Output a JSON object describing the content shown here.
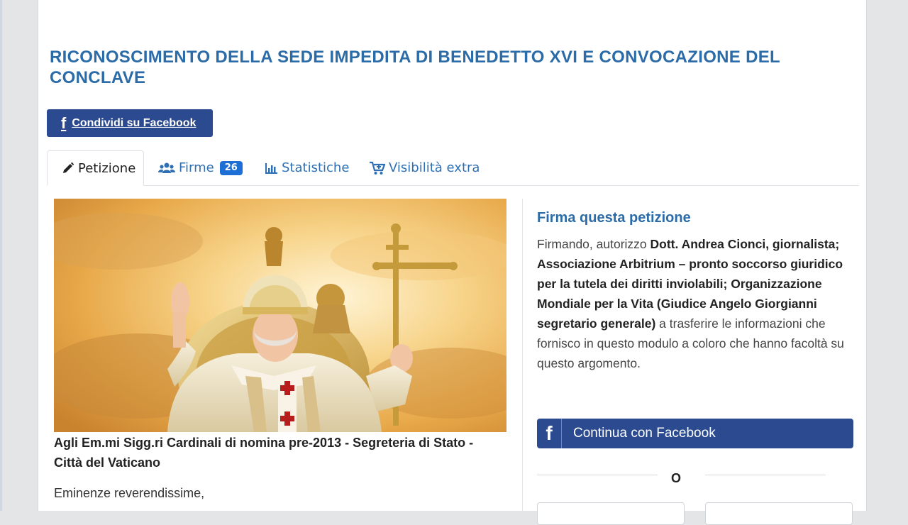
{
  "page": {
    "title": "RICONOSCIMENTO DELLA SEDE IMPEDITA DI BENEDETTO XVI E CONVOCAZIONE DEL CONCLAVE",
    "share_button": {
      "icon": "facebook-icon",
      "label": "Condividi su Facebook"
    }
  },
  "tabs": [
    {
      "label": "Petizione",
      "icon": "pencil-icon",
      "active": true
    },
    {
      "label": "Firme",
      "icon": "users-icon",
      "badge": "26"
    },
    {
      "label": "Statistiche",
      "icon": "bar-chart-icon"
    },
    {
      "label": "Visibilità extra",
      "icon": "cart-icon"
    }
  ],
  "main": {
    "caption": "Agli Em.mi Sigg.ri Cardinali di nomina pre-2013 - Segreteria di Stato - Città del Vaticano",
    "salutation": "Eminenze reverendissime,"
  },
  "sidebar": {
    "title": "Firma questa petizione",
    "text_intro": "Firmando, autorizzo ",
    "text_bold": "Dott. Andrea Cionci, giornalista; Associazione Arbitrium – pronto soccorso giuridico per la tutela dei diritti inviolabili; Organizzazione Mondiale per la Vita (Giudice Angelo Giorgianni segretario generale)",
    "text_end": " a trasferire le informazioni che fornisco in questo modulo a coloro che hanno facoltà su questo argomento.",
    "fb_button_label": "Continua con Facebook",
    "or_label": "O"
  },
  "colors": {
    "title": "#2b6ba7",
    "facebook": "#2b4a8f",
    "tab_link": "#2f6fb3",
    "badge": "#1d6fd6"
  }
}
